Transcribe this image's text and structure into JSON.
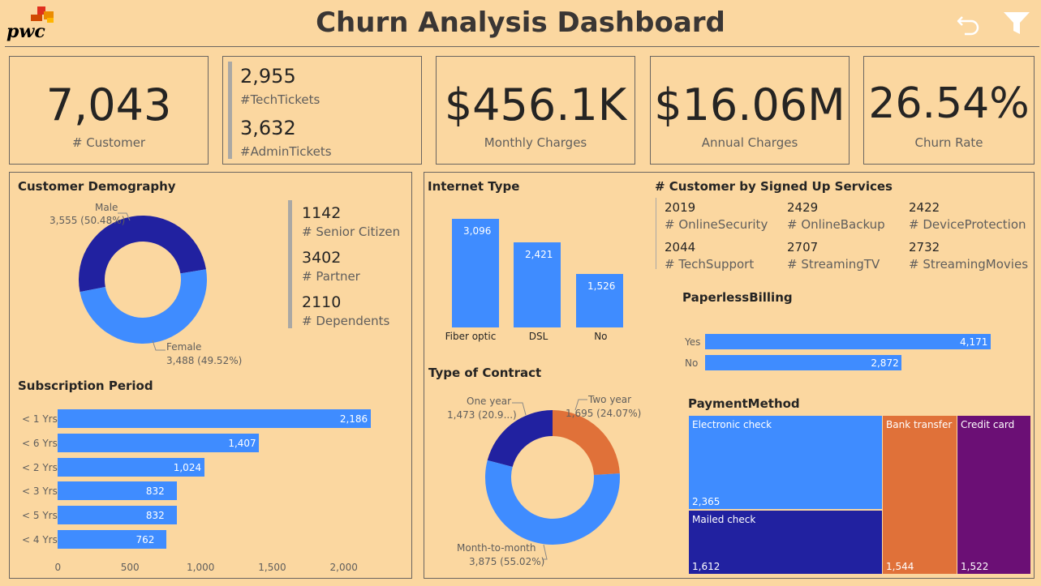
{
  "header": {
    "logo_text": "pwc",
    "title": "Churn Analysis Dashboard"
  },
  "kpis": {
    "customer": {
      "value": "7,043",
      "label": "# Customer"
    },
    "tech_tickets": {
      "value": "2,955",
      "label": "#TechTickets"
    },
    "admin_tickets": {
      "value": "3,632",
      "label": "#AdminTickets"
    },
    "monthly": {
      "value": "$456.1K",
      "label": "Monthly Charges"
    },
    "annual": {
      "value": "$16.06M",
      "label": "Annual Charges"
    },
    "churn": {
      "value": "26.54%",
      "label": "Churn Rate"
    }
  },
  "demography": {
    "title": "Customer Demography",
    "male_label": "Male",
    "male_value": "3,555 (50.48%)",
    "female_label": "Female",
    "female_value": "3,488 (49.52%)",
    "male_pct": 50.48,
    "female_pct": 49.52,
    "stats": [
      {
        "value": "1142",
        "label": "# Senior Citizen"
      },
      {
        "value": "3402",
        "label": "# Partner"
      },
      {
        "value": "2110",
        "label": "# Dependents"
      }
    ]
  },
  "subscription": {
    "title": "Subscription Period",
    "categories": [
      "< 1 Yrs",
      "< 6 Yrs",
      "< 2 Yrs",
      "< 3 Yrs",
      "< 5 Yrs",
      "< 4 Yrs"
    ],
    "values": [
      2186,
      1407,
      1024,
      832,
      832,
      762
    ],
    "value_labels": [
      "2,186",
      "1,407",
      "1,024",
      "832",
      "832",
      "762"
    ],
    "ticks": [
      "0",
      "500",
      "1,000",
      "1,500",
      "2,000"
    ],
    "xlim": [
      0,
      2000
    ]
  },
  "internet": {
    "title": "Internet Type",
    "categories": [
      "Fiber optic",
      "DSL",
      "No"
    ],
    "values": [
      3096,
      2421,
      1526
    ],
    "value_labels": [
      "3,096",
      "2,421",
      "1,526"
    ]
  },
  "contract": {
    "title": "Type of Contract",
    "one_year_label": "One year",
    "one_year_value": "1,473 (20.9...)",
    "two_year_label": "Two year",
    "two_year_value": "1,695 (24.07%)",
    "m2m_label": "Month-to-month",
    "m2m_value": "3,875 (55.02%)"
  },
  "services": {
    "title": "# Customer by Signed Up Services",
    "items": [
      {
        "value": "2019",
        "label": "# OnlineSecurity"
      },
      {
        "value": "2429",
        "label": "# OnlineBackup"
      },
      {
        "value": "2422",
        "label": "# DeviceProtection"
      },
      {
        "value": "2044",
        "label": "# TechSupport"
      },
      {
        "value": "2707",
        "label": "# StreamingTV"
      },
      {
        "value": "2732",
        "label": "# StreamingMovies"
      }
    ]
  },
  "paperless": {
    "title": "PaperlessBilling",
    "categories": [
      "Yes",
      "No"
    ],
    "values": [
      4171,
      2872
    ],
    "value_labels": [
      "4,171",
      "2,872"
    ]
  },
  "payment": {
    "title": "PaymentMethod",
    "items": [
      {
        "label": "Electronic check",
        "value": "2,365"
      },
      {
        "label": "Mailed check",
        "value": "1,612"
      },
      {
        "label": "Bank transfer",
        "value": "1,544"
      },
      {
        "label": "Credit card",
        "value": "1,522"
      }
    ]
  },
  "colors": {
    "background": "#fbd7a0",
    "bar_blue": "#3f8cff",
    "dark_blue": "#2121a0",
    "orange": "#e07139",
    "purple": "#6b0f75"
  },
  "chart_data": [
    {
      "type": "pie",
      "title": "Customer Demography",
      "categories": [
        "Male",
        "Female"
      ],
      "values": [
        3555,
        3488
      ]
    },
    {
      "type": "bar",
      "title": "Subscription Period",
      "categories": [
        "< 1 Yrs",
        "< 6 Yrs",
        "< 2 Yrs",
        "< 3 Yrs",
        "< 5 Yrs",
        "< 4 Yrs"
      ],
      "values": [
        2186,
        1407,
        1024,
        832,
        832,
        762
      ],
      "xlim": [
        0,
        2000
      ]
    },
    {
      "type": "bar",
      "title": "Internet Type",
      "categories": [
        "Fiber optic",
        "DSL",
        "No"
      ],
      "values": [
        3096,
        2421,
        1526
      ]
    },
    {
      "type": "pie",
      "title": "Type of Contract",
      "categories": [
        "One year",
        "Two year",
        "Month-to-month"
      ],
      "values": [
        1473,
        1695,
        3875
      ]
    },
    {
      "type": "bar",
      "title": "PaperlessBilling",
      "categories": [
        "Yes",
        "No"
      ],
      "values": [
        4171,
        2872
      ]
    },
    {
      "type": "table",
      "title": "PaymentMethod",
      "categories": [
        "Electronic check",
        "Mailed check",
        "Bank transfer",
        "Credit card"
      ],
      "values": [
        2365,
        1612,
        1544,
        1522
      ]
    }
  ]
}
